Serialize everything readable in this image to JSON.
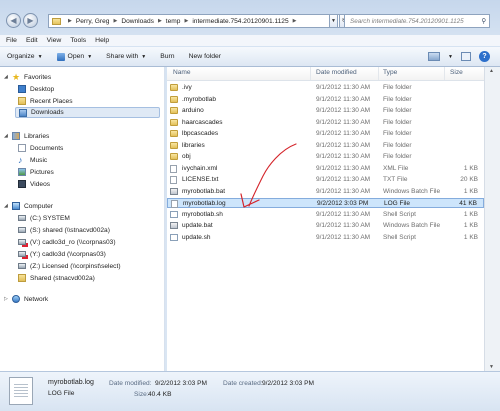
{
  "window": {
    "breadcrumb": [
      "Perry, Greg",
      "Downloads",
      "temp",
      "intermediate.754.20120901.1125"
    ],
    "search_placeholder": "Search intermediate.754.20120901.1125"
  },
  "menu": [
    "File",
    "Edit",
    "View",
    "Tools",
    "Help"
  ],
  "toolbar": {
    "organize": "Organize",
    "open": "Open",
    "share_with": "Share with",
    "burn": "Burn",
    "new_folder": "New folder"
  },
  "nav": {
    "favorites": "Favorites",
    "desktop": "Desktop",
    "recent_places": "Recent Places",
    "downloads": "Downloads",
    "libraries": "Libraries",
    "documents": "Documents",
    "music": "Music",
    "pictures": "Pictures",
    "videos": "Videos",
    "computer": "Computer",
    "drives": [
      "(C:) SYSTEM",
      "(S:) shared (\\\\stnacvd002a)",
      "(V:) cadlo3d_ro (\\\\corpnas03)",
      "(Y:) cadlo3d (\\\\corpnas03)",
      "(Z:) Licensed (\\\\corpinst\\select)",
      "Shared (stnacvd002a)"
    ],
    "network": "Network"
  },
  "columns": {
    "name": "Name",
    "date": "Date modified",
    "type": "Type",
    "size": "Size"
  },
  "files": [
    {
      "name": ".ivy",
      "date": "9/1/2012 11:30 AM",
      "type": "File folder",
      "size": "",
      "icon": "folder"
    },
    {
      "name": ".myrobotlab",
      "date": "9/1/2012 11:30 AM",
      "type": "File folder",
      "size": "",
      "icon": "folder"
    },
    {
      "name": "arduino",
      "date": "9/1/2012 11:30 AM",
      "type": "File folder",
      "size": "",
      "icon": "folder"
    },
    {
      "name": "haarcascades",
      "date": "9/1/2012 11:30 AM",
      "type": "File folder",
      "size": "",
      "icon": "folder"
    },
    {
      "name": "lbpcascades",
      "date": "9/1/2012 11:30 AM",
      "type": "File folder",
      "size": "",
      "icon": "folder"
    },
    {
      "name": "libraries",
      "date": "9/1/2012 11:30 AM",
      "type": "File folder",
      "size": "",
      "icon": "folder"
    },
    {
      "name": "obj",
      "date": "9/1/2012 11:30 AM",
      "type": "File folder",
      "size": "",
      "icon": "folder"
    },
    {
      "name": "ivychain.xml",
      "date": "9/1/2012 11:30 AM",
      "type": "XML File",
      "size": "1 KB",
      "icon": "file"
    },
    {
      "name": "LICENSE.txt",
      "date": "9/1/2012 11:30 AM",
      "type": "TXT File",
      "size": "20 KB",
      "icon": "file"
    },
    {
      "name": "myrobotlab.bat",
      "date": "9/1/2012 11:30 AM",
      "type": "Windows Batch File",
      "size": "1 KB",
      "icon": "bat"
    },
    {
      "name": "myrobotlab.log",
      "date": "9/2/2012 3:03 PM",
      "type": "LOG File",
      "size": "41 KB",
      "icon": "file",
      "selected": true
    },
    {
      "name": "myrobotlab.sh",
      "date": "9/1/2012 11:30 AM",
      "type": "Shell Script",
      "size": "1 KB",
      "icon": "sh"
    },
    {
      "name": "update.bat",
      "date": "9/1/2012 11:30 AM",
      "type": "Windows Batch File",
      "size": "1 KB",
      "icon": "bat"
    },
    {
      "name": "update.sh",
      "date": "9/1/2012 11:30 AM",
      "type": "Shell Script",
      "size": "1 KB",
      "icon": "sh"
    }
  ],
  "details": {
    "filename": "myrobotlab.log",
    "filetype": "LOG File",
    "modified_label": "Date modified:",
    "modified_value": "9/2/2012 3:03 PM",
    "size_label": "Size:",
    "size_value": "40.4 KB",
    "created_label": "Date created:",
    "created_value": "9/2/2012 3:03 PM"
  },
  "annotation_color": "#d4242a"
}
